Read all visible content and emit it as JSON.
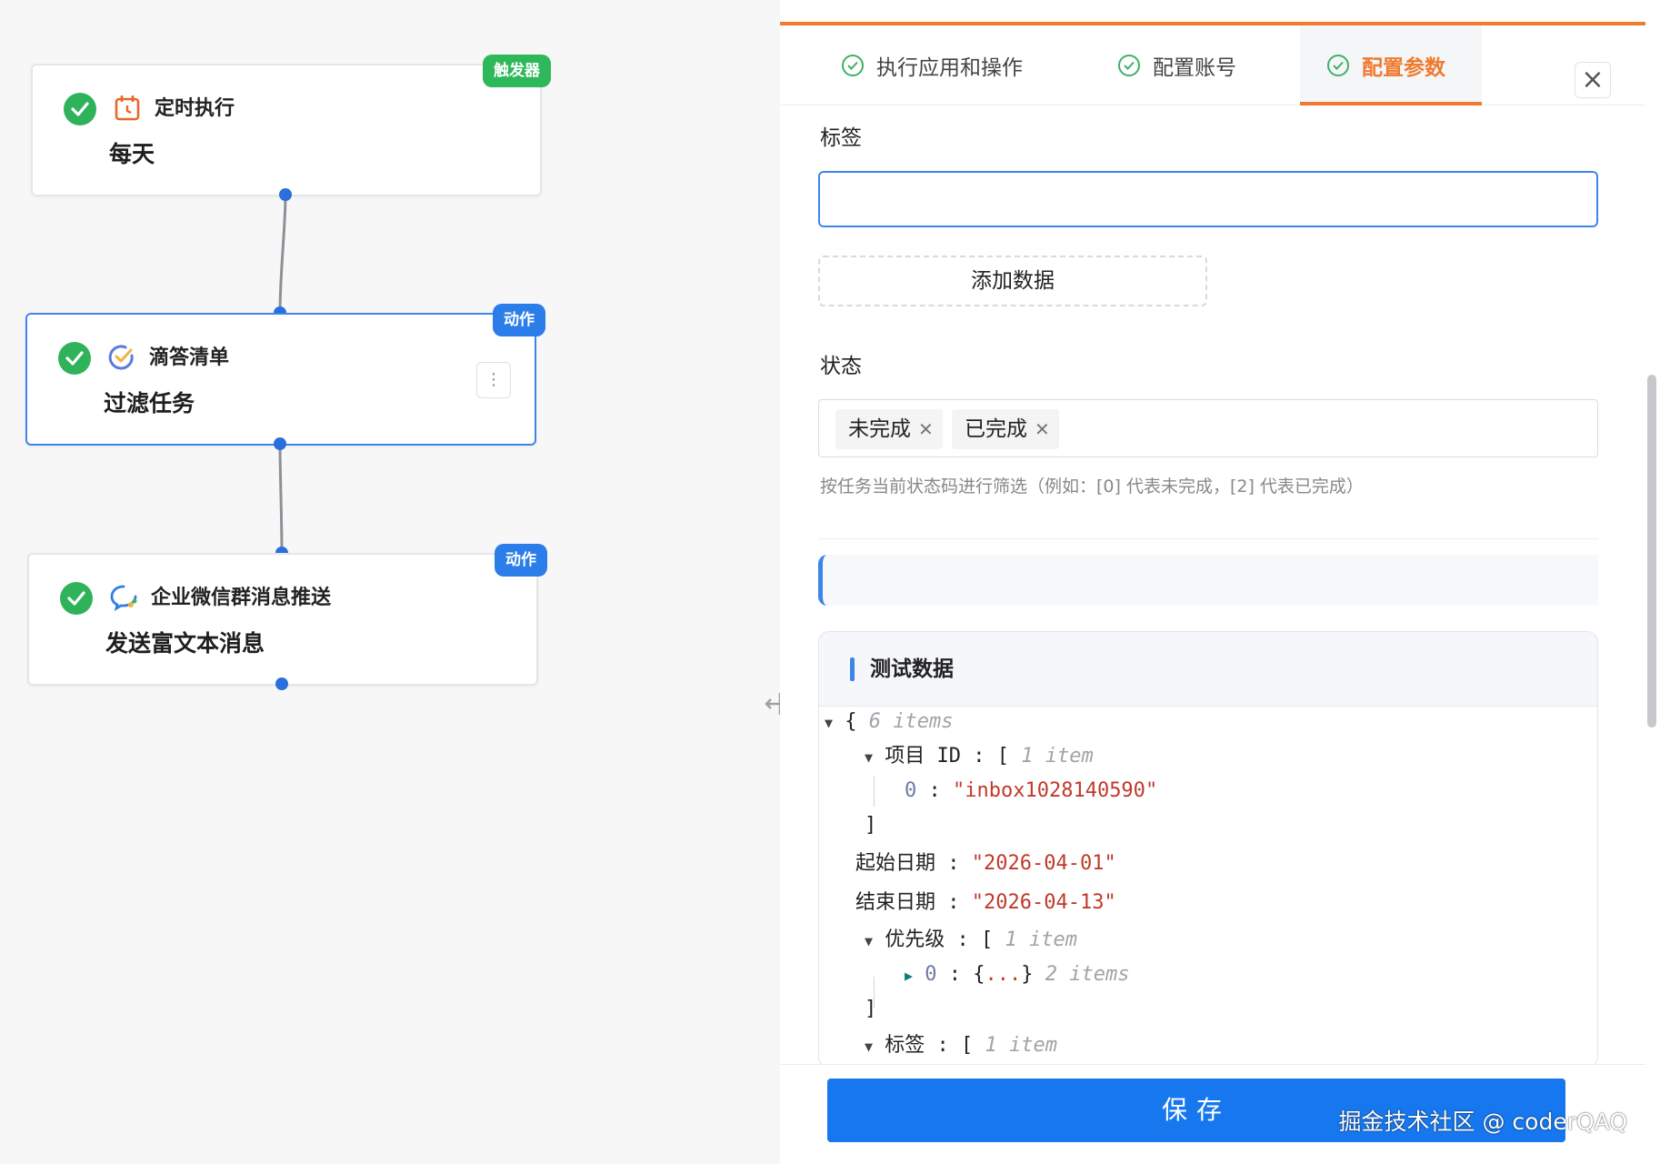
{
  "flow": {
    "nodes": [
      {
        "app": "定时执行",
        "operation": "每天",
        "badge": "触发器"
      },
      {
        "app": "滴答清单",
        "operation": "过滤任务",
        "badge": "动作",
        "more": "⋮"
      },
      {
        "app": "企业微信群消息推送",
        "operation": "发送富文本消息",
        "badge": "动作"
      }
    ]
  },
  "panel": {
    "tabs": [
      {
        "label": "执行应用和操作",
        "done": true
      },
      {
        "label": "配置账号",
        "done": true
      },
      {
        "label": "配置参数",
        "done": true,
        "active": true
      }
    ],
    "close_icon": "×",
    "tag_label": "标签",
    "tag_value": "",
    "add_data_label": "添加数据",
    "status_label": "状态",
    "status_selected": [
      "未完成",
      "已完成"
    ],
    "status_hint": "按任务当前状态码进行筛选（例如：[0] 代表未完成，[2] 代表已完成）",
    "test_data": {
      "title": "测试数据",
      "root_count": "6 items",
      "project_id_key": "项目 ID",
      "project_id_count": "1 item",
      "project_id_values": [
        "inbox1028140590"
      ],
      "start_date_key": "起始日期",
      "start_date": "2026-04-01",
      "end_date_key": "结束日期",
      "end_date": "2026-04-13",
      "priority_key": "优先级",
      "priority_count": "1 item",
      "priority_item_count": "2 items",
      "tag_key": "标签",
      "tag_count": "1 item"
    },
    "save_label": "保存"
  },
  "watermark": "掘金技术社区 @ coderQAQ",
  "colors": {
    "accent_orange": "#f07a2f",
    "primary_blue": "#1677ef",
    "success_green": "#2fb35a"
  }
}
